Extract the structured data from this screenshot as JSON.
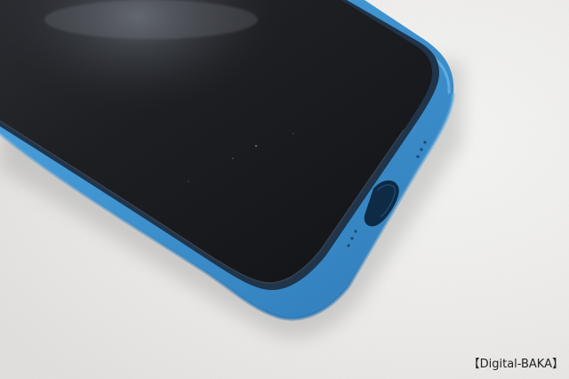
{
  "photo": {
    "subject": "phone-with-blue-silicone-case",
    "colors": {
      "background": "#eeeeec",
      "case_blue": "#3f93cf",
      "case_shadow": "#2c73ad",
      "screen_black": "#1a1b1e",
      "port_dark": "#0e2a44"
    }
  },
  "watermark": {
    "text": "【Digital-BAKA】"
  }
}
